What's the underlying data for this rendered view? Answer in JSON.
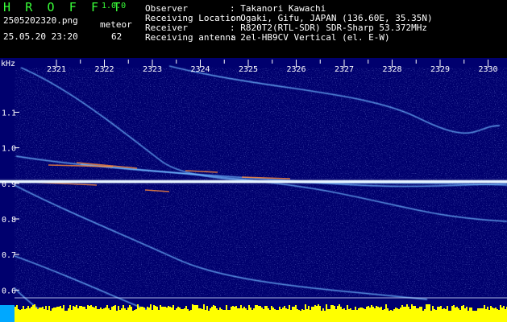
{
  "header": {
    "app_title": "H R O F F T",
    "app_version": "1.0.0",
    "filename": "2505202320.png",
    "meteor_label": "meteor",
    "datetime": "25.05.20 23:20",
    "meteor_count": "62",
    "info": [
      {
        "label": "Observer",
        "value": ": Takanori Kawachi"
      },
      {
        "label": "Receiving Location",
        "value": ": Ogaki, Gifu, JAPAN (136.60E, 35.35N)"
      },
      {
        "label": "Receiver",
        "value": ": R820T2(RTL-SDR) SDR-Sharp 53.372MHz"
      },
      {
        "label": "Receiving antenna",
        "value": ": 2el-HB9CV Vertical (el. E-W)"
      }
    ]
  },
  "spectrogram": {
    "y_unit": "kHz",
    "time_ticks": [
      "2321",
      "2322",
      "2323",
      "2324",
      "2325",
      "2326",
      "2327",
      "2328",
      "2329",
      "2330"
    ],
    "freq_ticks": [
      "1.1",
      "1.0",
      "0.9",
      "0.8",
      "0.7",
      "0.6"
    ],
    "y_range_khz": [
      0.56,
      1.23
    ],
    "background_color": "#00006e",
    "carrier_color": "#e6f5ff",
    "trace_color": "#6fb6ff",
    "noise_bar_color": "#ffff00",
    "noise_floor_color": "#00a8ff",
    "tick_color": "#ffffff"
  }
}
